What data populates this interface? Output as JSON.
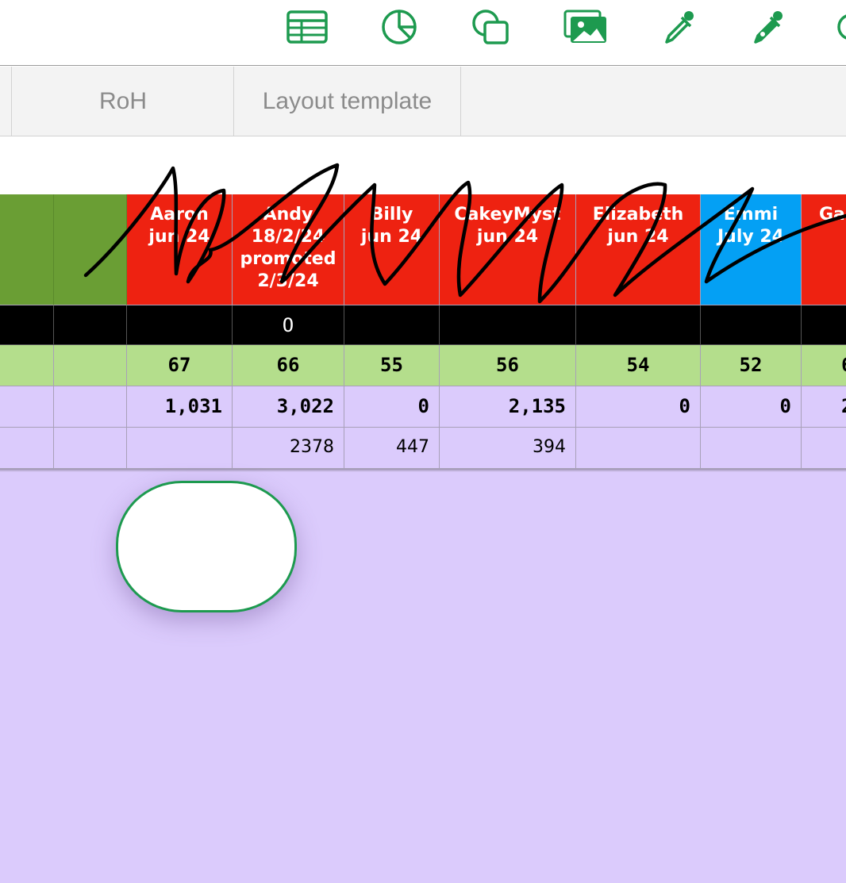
{
  "toolbar": {
    "icons": [
      "table-icon",
      "chart-icon",
      "shapes-icon",
      "media-icon",
      "eyedropper-icon",
      "eyedropper-filled-icon",
      "more-icon"
    ],
    "accent": "#1d9a4f"
  },
  "tabs": [
    {
      "label": "RoH"
    },
    {
      "label": "Layout template"
    }
  ],
  "sheet": {
    "header_cells": [
      {
        "text": "Aaron\njun 24",
        "color": "#ee2211"
      },
      {
        "text": "Andy\n18/2/24\npromoted\n2/3/24",
        "color": "#ee2211"
      },
      {
        "text": "Billy\njun 24",
        "color": "#ee2211"
      },
      {
        "text": "CakeyMyst\njun 24",
        "color": "#ee2211"
      },
      {
        "text": "Elizabeth\njun 24",
        "color": "#ee2211"
      },
      {
        "text": "Emmi\nJuly 24",
        "color": "#04a0f4"
      },
      {
        "text": "Ga",
        "color": "#ee2211"
      }
    ],
    "black_row": [
      "",
      "O",
      "",
      "",
      "",
      "",
      ""
    ],
    "green_row": [
      "67",
      "66",
      "55",
      "56",
      "54",
      "52",
      "6"
    ],
    "purple_row_1": [
      "1,031",
      "3,022",
      "0",
      "2,135",
      "0",
      "0",
      "2"
    ],
    "purple_row_2": [
      "",
      "2378",
      "447",
      "394",
      "",
      "",
      ""
    ],
    "colors": {
      "green_header": "#6a9e34",
      "black_row": "#000000",
      "green_row": "#b4de8c",
      "purple": "#dbcbfc"
    }
  }
}
